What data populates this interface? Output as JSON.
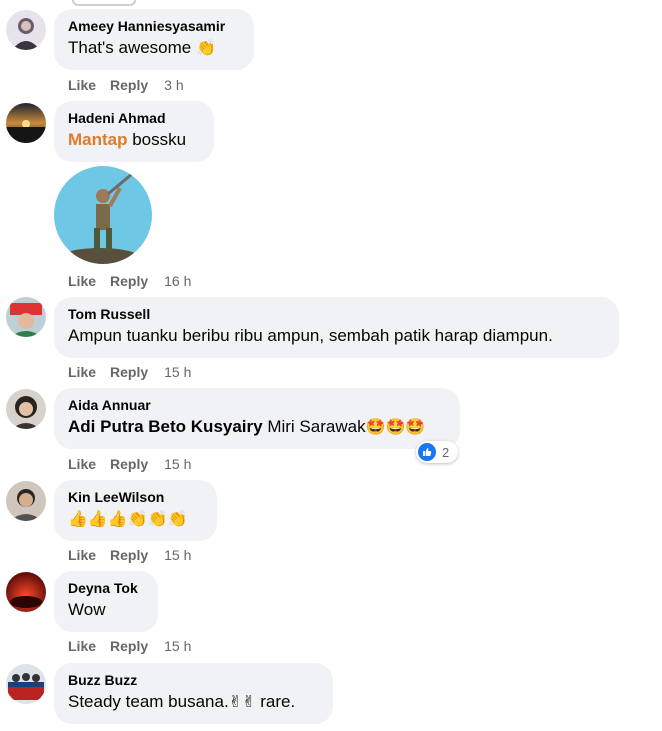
{
  "labels": {
    "like": "Like",
    "reply": "Reply"
  },
  "comments": [
    {
      "author": "Ameey Hanniesyasamir",
      "text": "That's awesome",
      "emoji": "👏",
      "time": "3 h"
    },
    {
      "author": "Hadeni Ahmad",
      "mention": "Mantap",
      "text": " bossku",
      "time": "16 h",
      "sticker": "sticker-warrior"
    },
    {
      "author": "Tom Russell",
      "text": "Ampun tuanku beribu ribu ampun, sembah patik harap diampun.",
      "time": "15 h"
    },
    {
      "author": "Aida Annuar",
      "mention": "Adi Putra Beto Kusyairy",
      "text": " Miri Sarawak",
      "emoji": "🤩🤩🤩",
      "time": "15 h",
      "reactions": {
        "icon": "like-icon",
        "count": "2"
      }
    },
    {
      "author": "Kin LeeWilson",
      "text": "",
      "emoji": "👍👍👍👏👏👏",
      "time": "15 h"
    },
    {
      "author": "Deyna Tok",
      "text": "Wow",
      "time": "15 h"
    },
    {
      "author": "Buzz Buzz",
      "text": "Steady team busana.",
      "emoji": "✌✌",
      "text2": " rare."
    }
  ],
  "colors": {
    "bubble": "#f0f2f5",
    "meta": "#65676b",
    "mention_orange": "#e07b2a",
    "like_blue": "#1877f2"
  }
}
